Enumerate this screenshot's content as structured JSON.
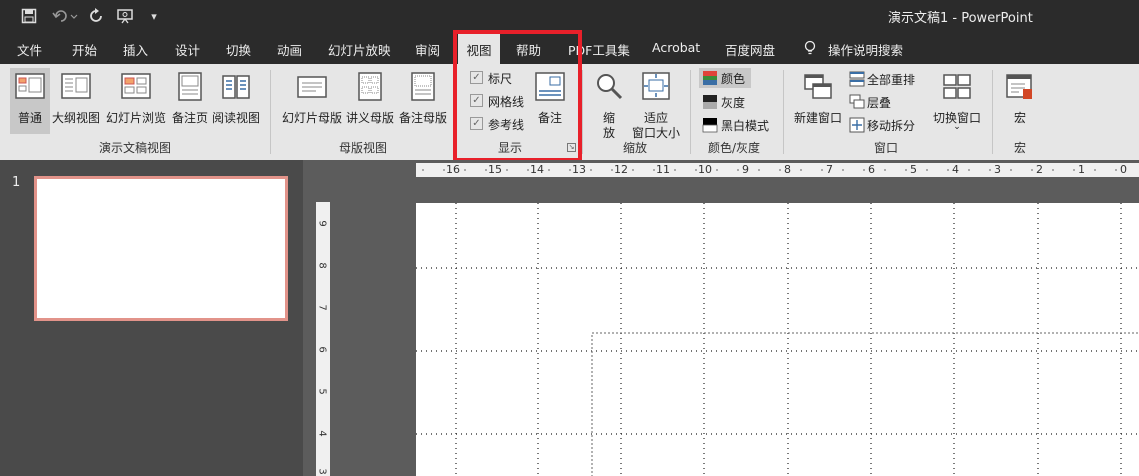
{
  "qat": {
    "save": "save-icon",
    "undo": "undo-icon",
    "redo": "redo-icon",
    "present": "present-icon",
    "more": "▾"
  },
  "title": "演示文稿1  -  PowerPoint",
  "tabs": [
    "文件",
    "开始",
    "插入",
    "设计",
    "切换",
    "动画",
    "幻灯片放映",
    "审阅",
    "视图",
    "帮助",
    "PDF工具集",
    "Acrobat",
    "百度网盘",
    "操作说明搜索"
  ],
  "active_tab": "视图",
  "ribbon": {
    "presentation_views": {
      "label": "演示文稿视图",
      "buttons": [
        "普通",
        "大纲视图",
        "幻灯片浏览",
        "备注页",
        "阅读视图"
      ]
    },
    "master_views": {
      "label": "母版视图",
      "buttons": [
        "幻灯片母版",
        "讲义母版",
        "备注母版"
      ]
    },
    "show": {
      "label": "显示",
      "checks": [
        {
          "label": "标尺",
          "checked": true
        },
        {
          "label": "网格线",
          "checked": true
        },
        {
          "label": "参考线",
          "checked": true
        }
      ],
      "notes": "备注"
    },
    "zoom": {
      "label": "缩放",
      "zoom_l1": "缩",
      "zoom_l2": "放",
      "fit_l1": "适应",
      "fit_l2": "窗口大小"
    },
    "color": {
      "label": "颜色/灰度",
      "items": [
        "颜色",
        "灰度",
        "黑白模式"
      ]
    },
    "window": {
      "label": "窗口",
      "new": "新建窗口",
      "arrange": "全部重排",
      "cascade": "层叠",
      "move_split": "移动拆分",
      "switch": "切换窗口"
    },
    "macro": {
      "label": "宏",
      "button": "宏"
    }
  },
  "ruler_h": [
    "16",
    "15",
    "14",
    "13",
    "12",
    "11",
    "10",
    "9",
    "8",
    "7",
    "6",
    "5",
    "4",
    "3",
    "2",
    "1",
    "0"
  ],
  "ruler_v": [
    "9",
    "8",
    "7",
    "6",
    "5",
    "4",
    "3"
  ],
  "slide_number": "1",
  "accent": "#d24726",
  "highlight": "#e8202a"
}
